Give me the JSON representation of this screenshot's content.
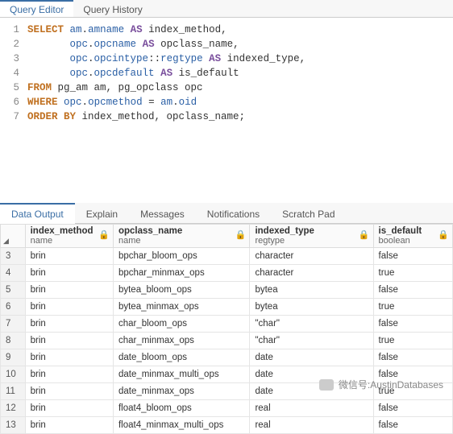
{
  "topTabs": {
    "editor": "Query Editor",
    "history": "Query History"
  },
  "code": [
    {
      "n": "1",
      "indent": "",
      "tokens": [
        [
          "kw",
          "SELECT"
        ],
        [
          "plain",
          " "
        ],
        [
          "ident",
          "am"
        ],
        [
          "dot",
          "."
        ],
        [
          "ident",
          "amname"
        ],
        [
          "plain",
          " "
        ],
        [
          "kw2",
          "AS"
        ],
        [
          "plain",
          " index_method,"
        ]
      ]
    },
    {
      "n": "2",
      "indent": "       ",
      "tokens": [
        [
          "ident",
          "opc"
        ],
        [
          "dot",
          "."
        ],
        [
          "ident",
          "opcname"
        ],
        [
          "plain",
          " "
        ],
        [
          "kw2",
          "AS"
        ],
        [
          "plain",
          " opclass_name,"
        ]
      ]
    },
    {
      "n": "3",
      "indent": "       ",
      "tokens": [
        [
          "ident",
          "opc"
        ],
        [
          "dot",
          "."
        ],
        [
          "ident",
          "opcintype"
        ],
        [
          "op",
          "::"
        ],
        [
          "ident",
          "regtype"
        ],
        [
          "plain",
          " "
        ],
        [
          "kw2",
          "AS"
        ],
        [
          "plain",
          " indexed_type,"
        ]
      ]
    },
    {
      "n": "4",
      "indent": "       ",
      "tokens": [
        [
          "ident",
          "opc"
        ],
        [
          "dot",
          "."
        ],
        [
          "ident",
          "opcdefault"
        ],
        [
          "plain",
          " "
        ],
        [
          "kw2",
          "AS"
        ],
        [
          "plain",
          " is_default"
        ]
      ]
    },
    {
      "n": "5",
      "indent": "",
      "tokens": [
        [
          "kw",
          "FROM"
        ],
        [
          "plain",
          " pg_am am, pg_opclass opc"
        ]
      ]
    },
    {
      "n": "6",
      "indent": "",
      "tokens": [
        [
          "kw",
          "WHERE"
        ],
        [
          "plain",
          " "
        ],
        [
          "ident",
          "opc"
        ],
        [
          "dot",
          "."
        ],
        [
          "ident",
          "opcmethod"
        ],
        [
          "plain",
          " = "
        ],
        [
          "ident",
          "am"
        ],
        [
          "dot",
          "."
        ],
        [
          "ident",
          "oid"
        ]
      ]
    },
    {
      "n": "7",
      "indent": "",
      "tokens": [
        [
          "kw",
          "ORDER BY"
        ],
        [
          "plain",
          " index_method, opclass_name;"
        ]
      ]
    }
  ],
  "bottomTabs": {
    "data": "Data Output",
    "explain": "Explain",
    "messages": "Messages",
    "notifications": "Notifications",
    "scratch": "Scratch Pad"
  },
  "columns": [
    {
      "title": "index_method",
      "type": "name"
    },
    {
      "title": "opclass_name",
      "type": "name"
    },
    {
      "title": "indexed_type",
      "type": "regtype"
    },
    {
      "title": "is_default",
      "type": "boolean"
    }
  ],
  "rows": [
    {
      "n": "3",
      "c": [
        "brin",
        "bpchar_bloom_ops",
        "character",
        "false"
      ]
    },
    {
      "n": "4",
      "c": [
        "brin",
        "bpchar_minmax_ops",
        "character",
        "true"
      ]
    },
    {
      "n": "5",
      "c": [
        "brin",
        "bytea_bloom_ops",
        "bytea",
        "false"
      ]
    },
    {
      "n": "6",
      "c": [
        "brin",
        "bytea_minmax_ops",
        "bytea",
        "true"
      ]
    },
    {
      "n": "7",
      "c": [
        "brin",
        "char_bloom_ops",
        "\"char\"",
        "false"
      ]
    },
    {
      "n": "8",
      "c": [
        "brin",
        "char_minmax_ops",
        "\"char\"",
        "true"
      ]
    },
    {
      "n": "9",
      "c": [
        "brin",
        "date_bloom_ops",
        "date",
        "false"
      ]
    },
    {
      "n": "10",
      "c": [
        "brin",
        "date_minmax_multi_ops",
        "date",
        "false"
      ]
    },
    {
      "n": "11",
      "c": [
        "brin",
        "date_minmax_ops",
        "date",
        "true"
      ]
    },
    {
      "n": "12",
      "c": [
        "brin",
        "float4_bloom_ops",
        "real",
        "false"
      ]
    },
    {
      "n": "13",
      "c": [
        "brin",
        "float4_minmax_multi_ops",
        "real",
        "false"
      ]
    }
  ],
  "watermark": {
    "label": "微信号",
    "value": "AustinDatabases"
  }
}
